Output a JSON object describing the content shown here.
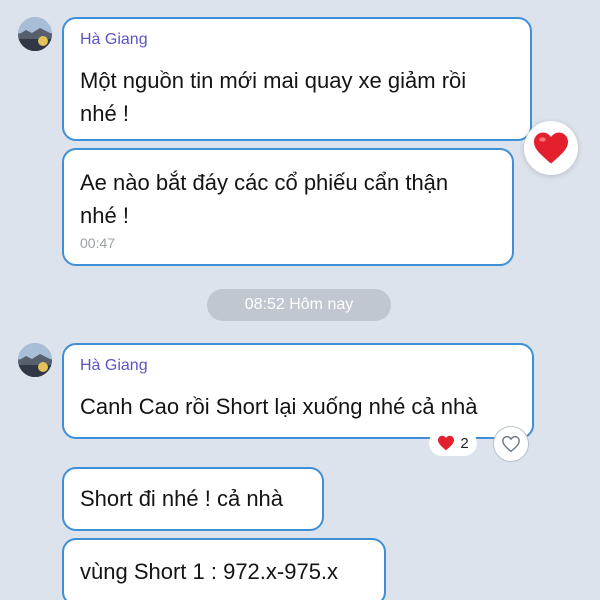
{
  "messages": [
    {
      "sender": "Hà Giang",
      "text": "Một nguồn tin mới mai quay xe giảm rồi\nnhé !"
    },
    {
      "text": "Ae nào bắt đáy các cổ phiếu cẩn thận\nnhé !",
      "time": "00:47"
    },
    {
      "sender": "Hà Giang",
      "text": "Canh Cao rồi Short lại xuống nhé cả nhà",
      "reaction_count": "2"
    },
    {
      "text": "Short đi nhé ! cả nhà"
    },
    {
      "text": "vùng Short 1 : 972.x-975.x"
    }
  ],
  "date_separator": "08:52 Hôm nay",
  "icons": {
    "avatar": "avatar-landscape-icon",
    "big_reaction": "heart-icon",
    "small_reaction": "heart-icon",
    "like_button": "heart-outline-icon"
  },
  "colors": {
    "background": "#dde3ec",
    "bubble_border": "#3f8fd6",
    "sender_name": "#5b55c4",
    "heart": "#e5202e",
    "timestamp": "#9aa0a8"
  }
}
